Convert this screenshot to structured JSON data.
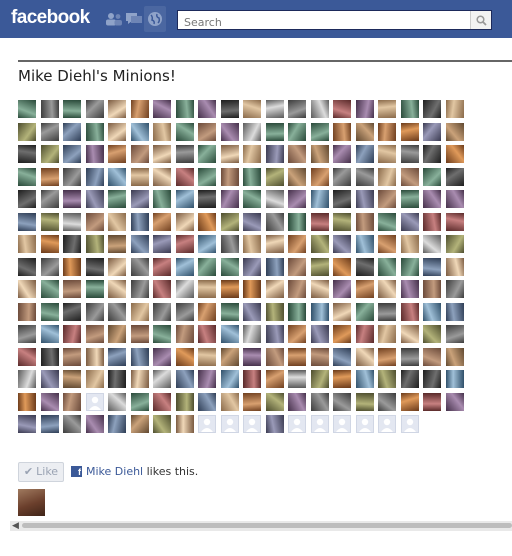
{
  "header": {
    "logo_text": "facebook",
    "brand_color": "#3b5998",
    "icons": [
      "friend-requests-icon",
      "messages-icon",
      "notifications-globe-icon"
    ],
    "search": {
      "placeholder": "Search",
      "value": ""
    }
  },
  "page": {
    "title": "Mike Diehl's Minions!"
  },
  "friends_grid": {
    "columns": 20,
    "rows": 15,
    "filled_last_row": 18,
    "placeholder_indices": [
      263,
      288,
      289,
      290,
      292,
      293,
      294,
      295,
      296,
      297,
      298
    ]
  },
  "like_bar": {
    "button_label": "Like",
    "liker_name": "Mike Diehl",
    "suffix": "likes this."
  }
}
